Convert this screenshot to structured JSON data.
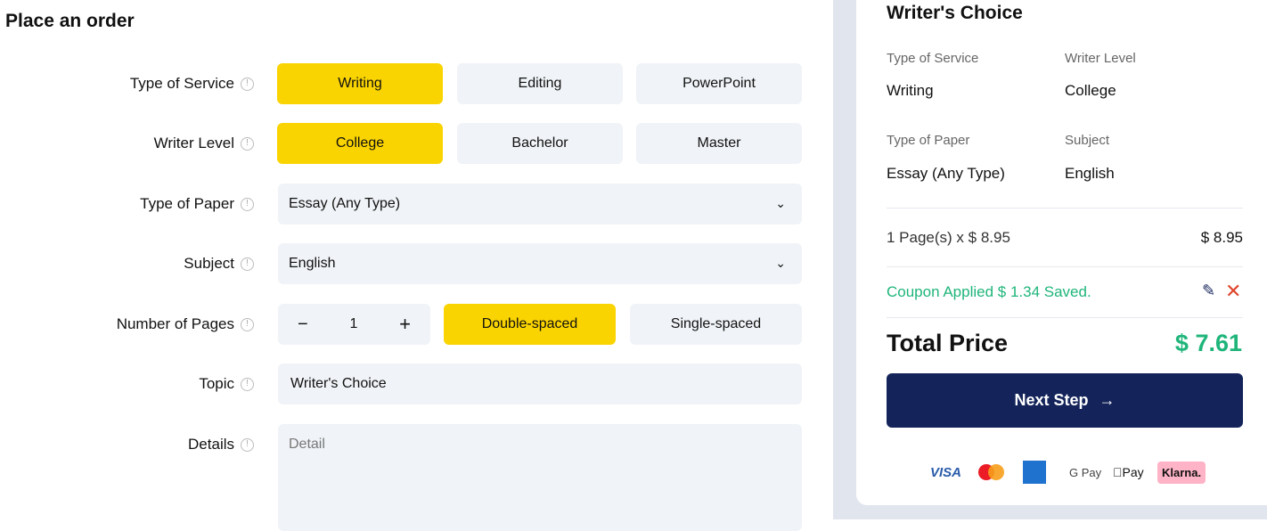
{
  "form": {
    "title": "Place an order",
    "service": {
      "label": "Type of Service",
      "options": [
        "Writing",
        "Editing",
        "PowerPoint"
      ],
      "selected": "Writing"
    },
    "level": {
      "label": "Writer Level",
      "options": [
        "College",
        "Bachelor",
        "Master"
      ],
      "selected": "College"
    },
    "paper": {
      "label": "Type of Paper",
      "value": "Essay (Any Type)"
    },
    "subject": {
      "label": "Subject",
      "value": "English"
    },
    "pages": {
      "label": "Number of Pages",
      "minus": "−",
      "value": "1",
      "plus": "+",
      "spacing": [
        "Double-spaced",
        "Single-spaced"
      ],
      "selected": "Double-spaced"
    },
    "topic": {
      "label": "Topic",
      "value": "Writer's Choice"
    },
    "details": {
      "label": "Details",
      "placeholder": "Detail"
    }
  },
  "summary": {
    "title": "Writer's Choice",
    "service_label": "Type of Service",
    "service": "Writing",
    "level_label": "Writer Level",
    "level": "College",
    "paper_label": "Type of Paper",
    "paper": "Essay (Any Type)",
    "subject_label": "Subject",
    "subject": "English",
    "pages_line": "1 Page(s) x $ 8.95",
    "pages_price": "$ 8.95",
    "coupon": "Coupon Applied $ 1.34 Saved.",
    "total_label": "Total Price",
    "total": "$ 7.61",
    "next": "Next Step",
    "payments": [
      "VISA",
      "Mastercard",
      "American Express",
      "G Pay",
      "Pay",
      "Klarna."
    ]
  },
  "colors": {
    "accent": "#fad400",
    "navy": "#14245a",
    "green": "#1fb57a",
    "red": "#e0452b"
  }
}
